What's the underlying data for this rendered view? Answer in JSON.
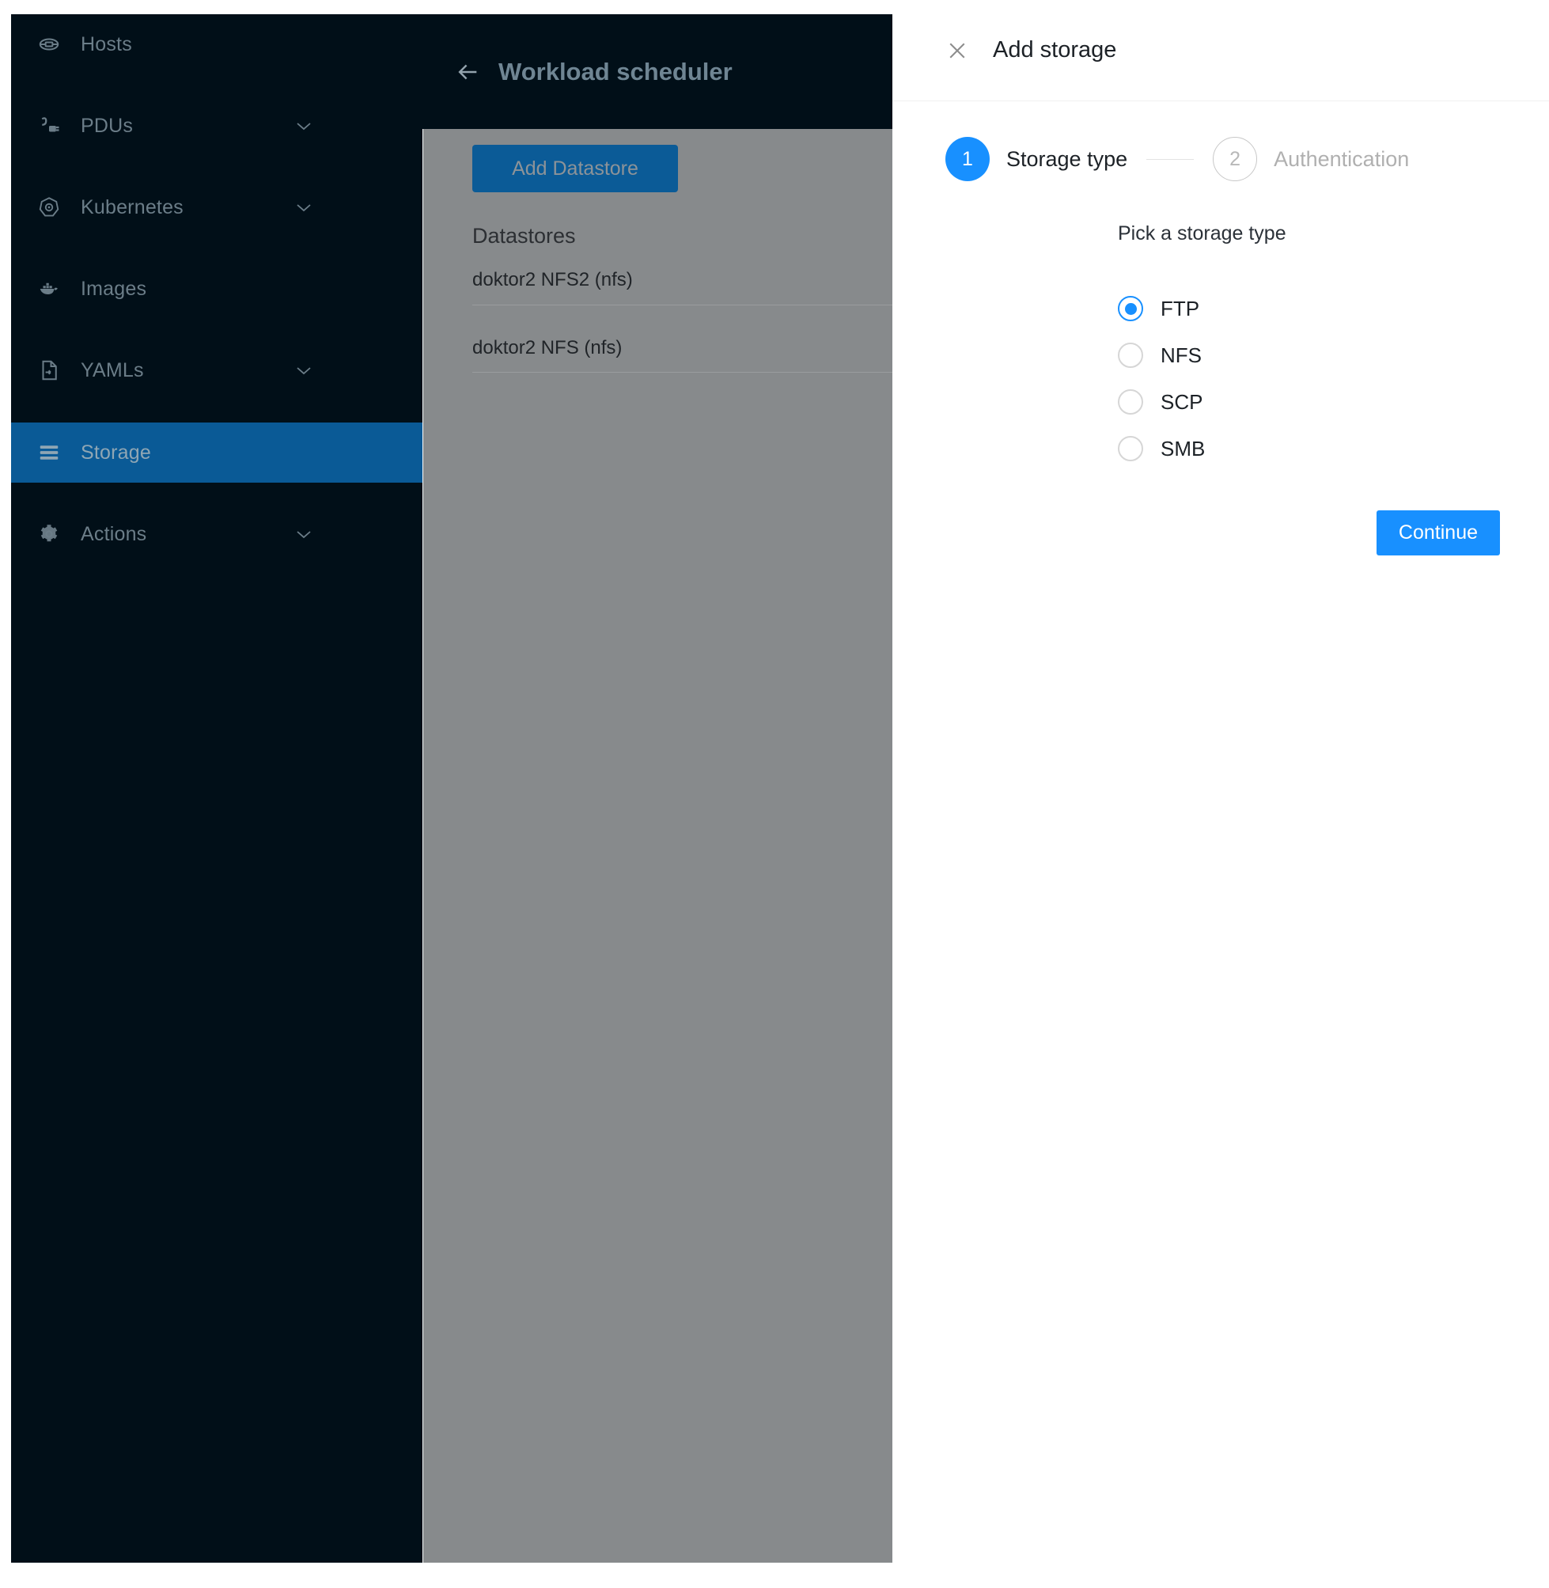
{
  "sidebar": {
    "items": [
      {
        "label": "Hosts",
        "icon": "cloud-server-icon",
        "expandable": false,
        "active": false
      },
      {
        "label": "PDUs",
        "icon": "power-plug-icon",
        "expandable": true,
        "active": false
      },
      {
        "label": "Kubernetes",
        "icon": "kubernetes-icon",
        "expandable": true,
        "active": false
      },
      {
        "label": "Images",
        "icon": "docker-whale-icon",
        "expandable": false,
        "active": false
      },
      {
        "label": "YAMLs",
        "icon": "file-yaml-icon",
        "expandable": true,
        "active": false
      },
      {
        "label": "Storage",
        "icon": "list-icon",
        "expandable": false,
        "active": true
      },
      {
        "label": "Actions",
        "icon": "gear-icon",
        "expandable": true,
        "active": false
      }
    ],
    "active_color": "#0a5a96"
  },
  "middle": {
    "back_icon": "back-arrow-icon",
    "title": "Workload scheduler",
    "add_datastore_label": "Add Datastore",
    "datastores_heading": "Datastores",
    "datastores": [
      "doktor2 NFS2 (nfs)",
      "doktor2 NFS (nfs)"
    ],
    "button_color": "#0b5b97"
  },
  "drawer": {
    "close_icon": "close-icon",
    "title": "Add storage",
    "steps": [
      {
        "number": "1",
        "label": "Storage type",
        "state": "active"
      },
      {
        "number": "2",
        "label": "Authentication",
        "state": "inactive"
      }
    ],
    "prompt": "Pick a storage type",
    "options": [
      {
        "value": "FTP",
        "selected": true
      },
      {
        "value": "NFS",
        "selected": false
      },
      {
        "value": "SCP",
        "selected": false
      },
      {
        "value": "SMB",
        "selected": false
      }
    ],
    "continue_label": "Continue",
    "accent_color": "#1890ff"
  }
}
